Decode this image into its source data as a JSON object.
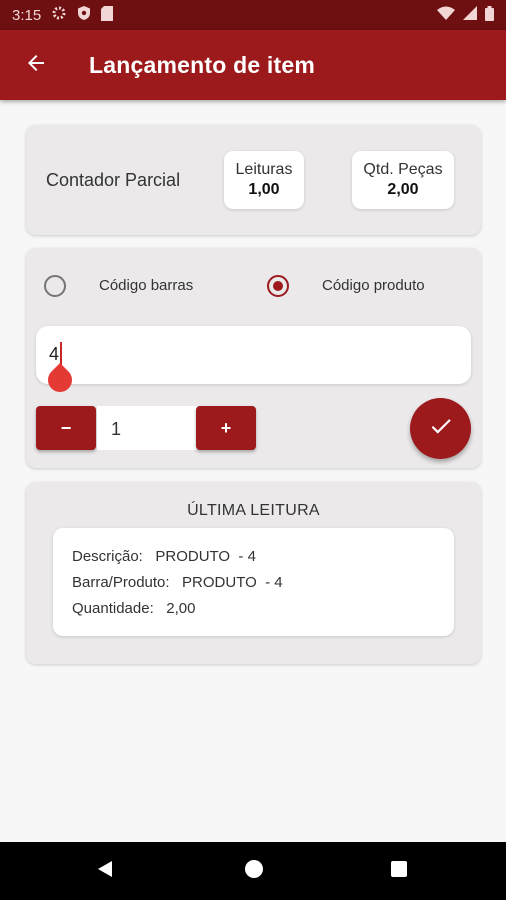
{
  "status_bar": {
    "time": "3:15",
    "icons": [
      "settings-icon",
      "shield-icon",
      "sd-card-icon",
      "wifi-icon",
      "signal-icon",
      "battery-icon"
    ]
  },
  "app_bar": {
    "back_icon": "arrow-left-icon",
    "title": "Lançamento de item"
  },
  "counter_card": {
    "label": "Contador Parcial",
    "leituras_label": "Leituras",
    "leituras_value": "1,00",
    "pecas_label": "Qtd. Peças",
    "pecas_value": "2,00"
  },
  "entry_card": {
    "option_barras": "Código barras",
    "option_produto": "Código produto",
    "selected_option": "Código produto",
    "code_value": "4",
    "quantity_value": "1",
    "minus_label": "−",
    "plus_label": "+",
    "confirm_icon": "check-icon"
  },
  "last_reading": {
    "title": "ÚLTIMA LEITURA",
    "descricao": "Descrição:   PRODUTO  - 4",
    "barra_produto": "Barra/Produto:   PRODUTO  - 4",
    "quantidade": "Quantidade:   2,00"
  },
  "colors": {
    "primary": "#9c1a1c",
    "status_bar": "#6e0f12",
    "card": "#ebe9ea",
    "background": "#f7f7f7"
  }
}
